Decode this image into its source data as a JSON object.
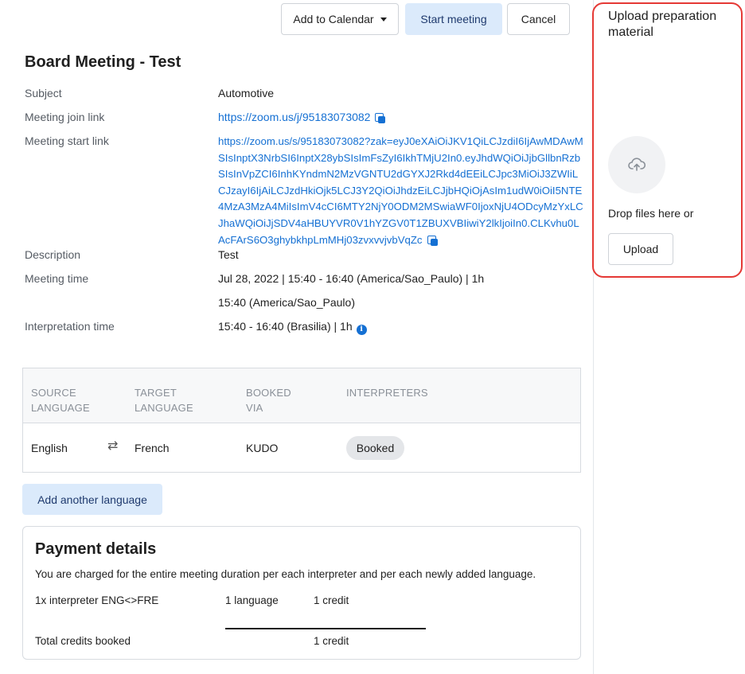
{
  "header": {
    "add_to_calendar_label": "Add to Calendar",
    "start_meeting_label": "Start meeting",
    "cancel_label": "Cancel"
  },
  "meeting": {
    "title": "Board Meeting - Test",
    "fields": {
      "subject_label": "Subject",
      "subject_value": "Automotive",
      "join_link_label": "Meeting join link",
      "join_link_value": "https://zoom.us/j/95183073082",
      "start_link_label": "Meeting start link",
      "start_link_value": "https://zoom.us/s/95183073082?zak=eyJ0eXAiOiJKV1QiLCJzdiI6IjAwMDAwMSIsInptX3NrbSI6InptX28ybSIsImFsZyI6IkhTMjU2In0.eyJhdWQiOiJjbGllbnRzbSIsInVpZCI6InhKYndmN2MzVGNTU2dGYXJ2Rkd4dEEiLCJpc3MiOiJ3ZWIiLCJzayI6IjAiLCJzdHkiOjk5LCJ3Y2QiOiJhdzEiLCJjbHQiOjAsIm1udW0iOiI5NTE4MzA3MzA4MiIsImV4cCI6MTY2NjY0ODM2MSwiaWF0IjoxNjU4ODcyMzYxLCJhaWQiOiJjSDV4aHBUYVR0V1hYZGV0T1ZBUXVBIiwiY2lkIjoiIn0.CLKvhu0LAcFArS6O3ghybkhpLmMHj03zvxvvjvbVqZc",
      "description_label": "Description",
      "description_value": "Test",
      "meeting_time_label": "Meeting time",
      "meeting_time_value": "Jul 28, 2022 | 15:40 - 16:40 (America/Sao_Paulo) | 1h",
      "meeting_time_value2": "15:40 (America/Sao_Paulo)",
      "interpretation_time_label": "Interpretation time",
      "interpretation_time_value": "15:40 - 16:40 (Brasilia) | 1h"
    }
  },
  "languages_table": {
    "headers": {
      "source_line1": "SOURCE",
      "source_line2": "LANGUAGE",
      "target_line1": "TARGET",
      "target_line2": "LANGUAGE",
      "booked_line1": "BOOKED",
      "booked_line2": "VIA",
      "interpreters": "INTERPRETERS"
    },
    "rows": [
      {
        "source": "English",
        "target": "French",
        "booked_via": "KUDO",
        "status": "Booked"
      }
    ]
  },
  "add_language_label": "Add another language",
  "payment": {
    "title": "Payment details",
    "description": "You are charged for the entire meeting duration per each interpreter and per each newly added language.",
    "line_item": {
      "label": "1x interpreter ENG<>FRE",
      "languages": "1 language",
      "credits": "1 credit"
    },
    "total": {
      "label": "Total credits booked",
      "credits": "1 credit"
    }
  },
  "upload": {
    "title": "Upload preparation material",
    "drop_text": "Drop files here or",
    "button_label": "Upload"
  },
  "icons": {
    "copy": "copy-icon",
    "info": "info-icon",
    "swap": "swap-arrows-icon",
    "upload": "cloud-upload-icon",
    "caret": "caret-down-icon"
  },
  "colors": {
    "link": "#1570d3",
    "primary_soft": "#dbeafb",
    "highlight_border": "#e53935"
  }
}
